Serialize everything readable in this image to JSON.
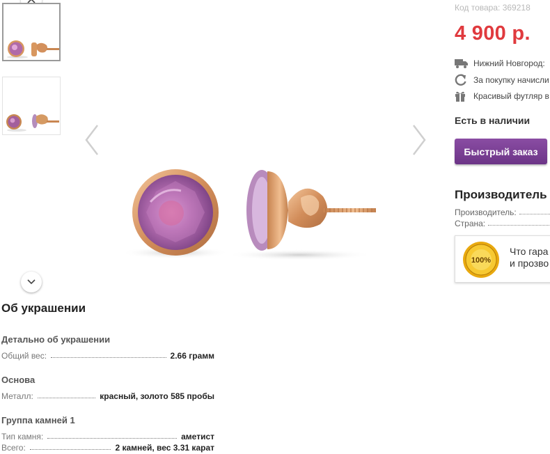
{
  "product": {
    "code_label": "Код товара: 369218",
    "price": "4 900 р.",
    "info": [
      {
        "icon": "truck-icon",
        "text": "Нижний Новгород:"
      },
      {
        "icon": "refresh-icon",
        "text": "За покупку начисли"
      },
      {
        "icon": "gift-icon",
        "text": "Красивый футляр в"
      }
    ],
    "stock": "Есть в наличии",
    "quick_order": "Быстрый заказ"
  },
  "maker": {
    "title": "Производитель и",
    "rows": [
      {
        "label": "Производитель:"
      },
      {
        "label": "Страна:"
      }
    ],
    "guarantee_badge": "100%",
    "guarantee_text_1": "Что гара",
    "guarantee_text_2": "и прозво"
  },
  "details": {
    "title": "Об украшении",
    "groups": [
      {
        "title": "Детально об украшении",
        "rows": [
          {
            "label": "Общий вес:",
            "value": "2.66 грамм"
          }
        ]
      },
      {
        "title": "Основа",
        "rows": [
          {
            "label": "Металл:",
            "value": "красный, золото 585 пробы"
          }
        ]
      },
      {
        "title": "Группа камней 1",
        "rows": [
          {
            "label": "Тип камня:",
            "value": "аметист"
          },
          {
            "label": "Всего:",
            "value": "2 камней, вес 3.31 карат"
          }
        ]
      }
    ]
  },
  "colors": {
    "price": "#e03a3e",
    "button": "#7a3f94",
    "gold": "#d99b6c",
    "amethyst": "#b070b0"
  }
}
